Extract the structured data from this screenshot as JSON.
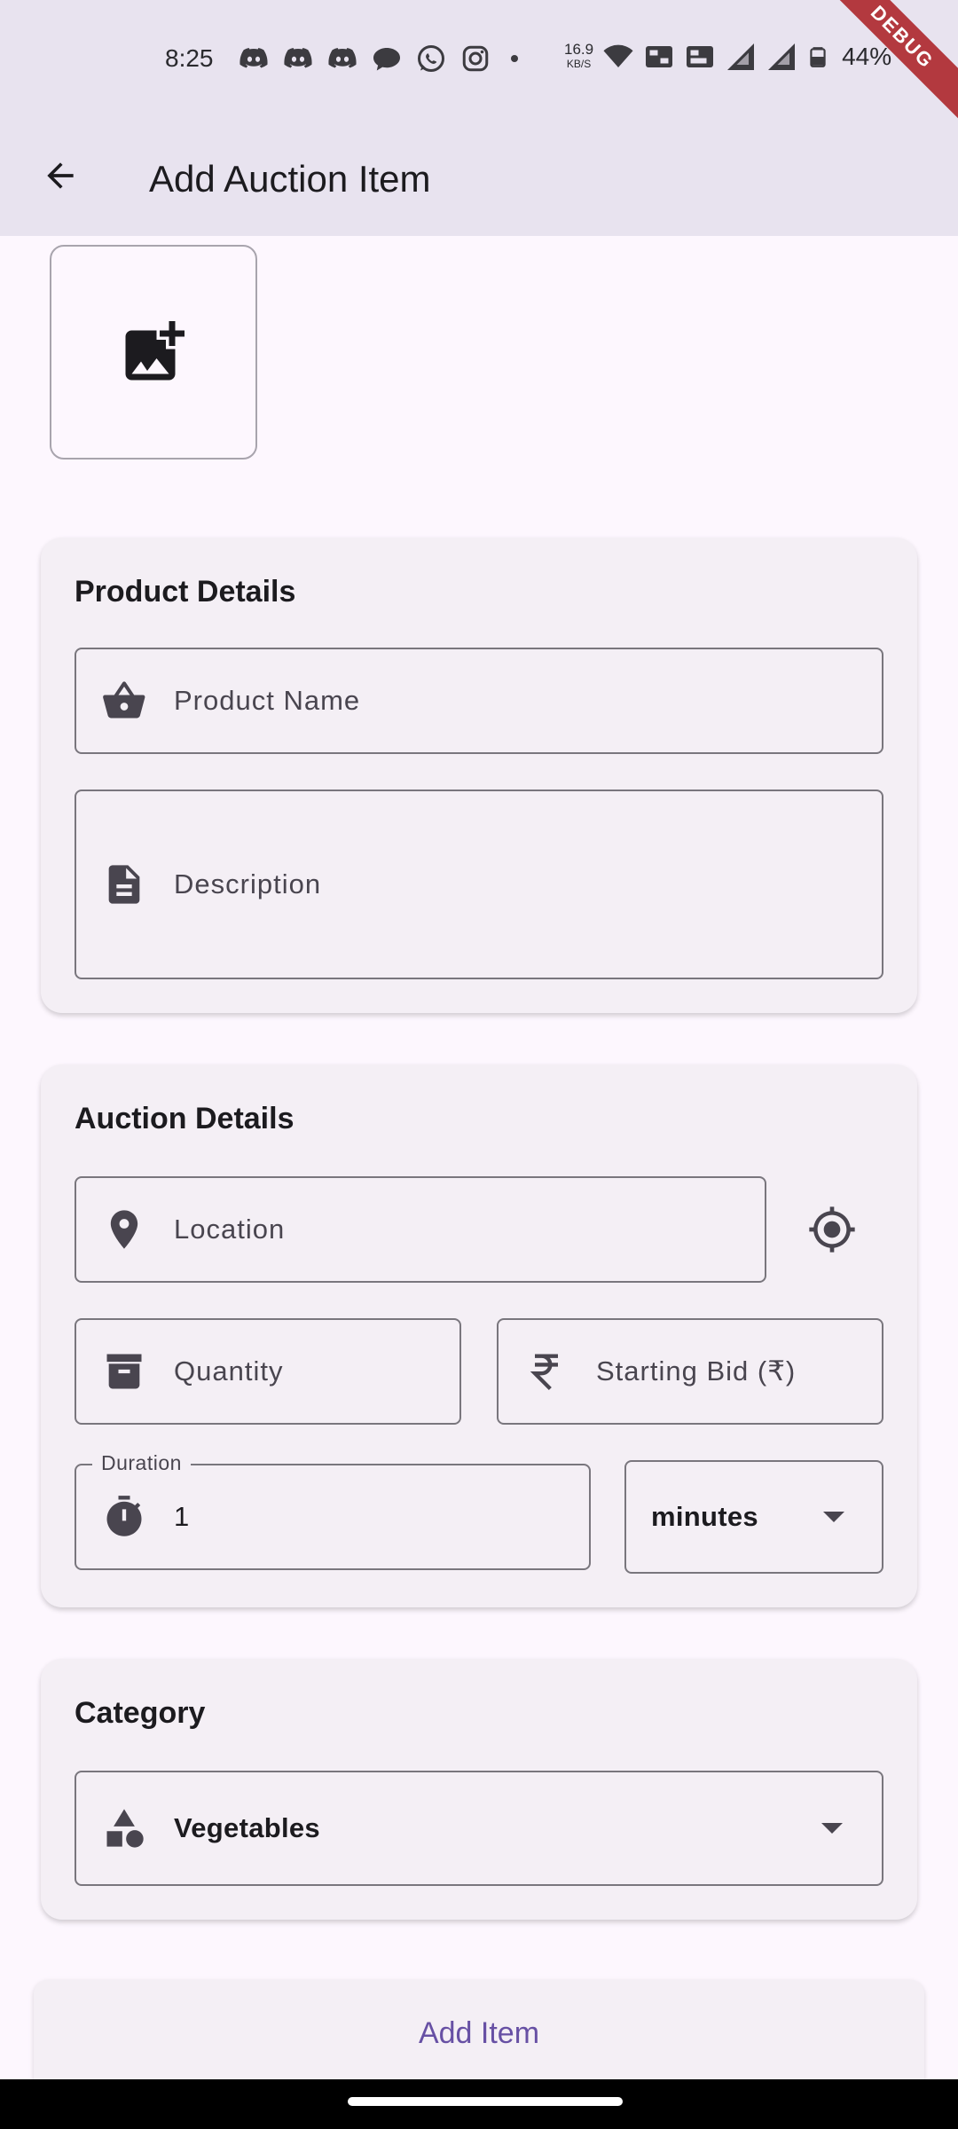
{
  "status_bar": {
    "time": "8:25",
    "net_speed_value": "16.9",
    "net_speed_unit": "KB/S",
    "battery": "44%",
    "debug_label": "DEBUG",
    "icons": [
      "discord-icon",
      "discord-icon",
      "discord-icon",
      "chat-bubble-icon",
      "whatsapp-icon",
      "instagram-icon",
      "dot-icon",
      "wifi-icon",
      "vowifi-icon",
      "volte-icon",
      "signal-icon",
      "signal-icon",
      "battery-icon"
    ]
  },
  "app_bar": {
    "title": "Add Auction Item"
  },
  "product_details": {
    "title": "Product Details",
    "product_name_placeholder": "Product Name",
    "description_placeholder": "Description"
  },
  "auction_details": {
    "title": "Auction Details",
    "location_placeholder": "Location",
    "quantity_placeholder": "Quantity",
    "starting_bid_placeholder": "Starting Bid (₹)",
    "duration_label": "Duration",
    "duration_value": "1",
    "duration_unit": "minutes"
  },
  "category": {
    "title": "Category",
    "selected": "Vegetables"
  },
  "actions": {
    "add_item_label": "Add Item"
  },
  "colors": {
    "app_bar_bg": "#e8e3ef",
    "page_bg": "#fdf7fe",
    "card_bg": "#f4eff5",
    "accent": "#6750a4",
    "debug_banner": "#b3393f"
  }
}
